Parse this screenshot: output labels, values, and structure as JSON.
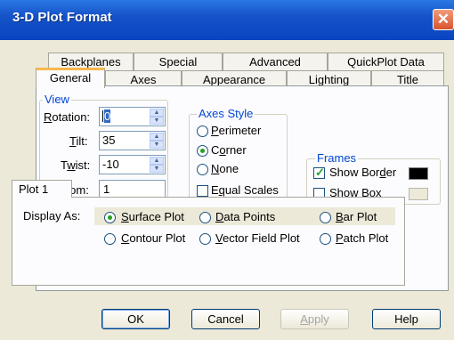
{
  "window": {
    "title": "3-D Plot Format",
    "close_glyph": "✕"
  },
  "tabs_back": [
    "Backplanes",
    "Special",
    "Advanced",
    "QuickPlot Data"
  ],
  "tabs_front": [
    "General",
    "Axes",
    "Appearance",
    "Lighting",
    "Title"
  ],
  "active_tab": "General",
  "view": {
    "title": "View",
    "rotation": {
      "label_u": "R",
      "label_rest": "otation:",
      "value": "0"
    },
    "tilt": {
      "label_u": "T",
      "label_rest": "ilt:",
      "value": "35"
    },
    "twist": {
      "label_pre": "T",
      "label_u": "w",
      "label_rest": "ist:",
      "value": "-10"
    },
    "zoom": {
      "label_u": "Z",
      "label_rest": "oom:",
      "value": "1"
    }
  },
  "axes_style": {
    "title": "Axes Style",
    "options": [
      {
        "u": "P",
        "rest": "erimeter",
        "selected": false
      },
      {
        "pre": "C",
        "u": "o",
        "rest": "rner",
        "selected": true
      },
      {
        "u": "N",
        "rest": "one",
        "selected": false
      }
    ],
    "equal_scales": {
      "pre": "E",
      "u": "q",
      "rest": "ual Scales",
      "checked": false
    }
  },
  "frames": {
    "title": "Frames",
    "show_border": {
      "pre": "Show Bor",
      "u": "d",
      "rest": "er",
      "checked": true,
      "color": "#000000"
    },
    "show_box": {
      "pre": "Show Bo",
      "u": "x",
      "rest": "",
      "checked": false,
      "color": "#ece9d8"
    }
  },
  "plot": {
    "tab_label": "Plot 1",
    "display_as_label": "Display As:",
    "options": [
      {
        "u": "S",
        "rest": "urface Plot",
        "selected": true
      },
      {
        "u": "D",
        "rest": "ata Points",
        "selected": false
      },
      {
        "u": "B",
        "rest": "ar Plot",
        "selected": false
      },
      {
        "u": "C",
        "rest": "ontour Plot",
        "selected": false
      },
      {
        "u": "V",
        "rest": "ector Field Plot",
        "selected": false
      },
      {
        "u": "P",
        "rest": "atch Plot",
        "selected": false
      }
    ]
  },
  "buttons": {
    "ok": "OK",
    "cancel": "Cancel",
    "apply_u": "A",
    "apply_rest": "pply",
    "help": "Help"
  }
}
